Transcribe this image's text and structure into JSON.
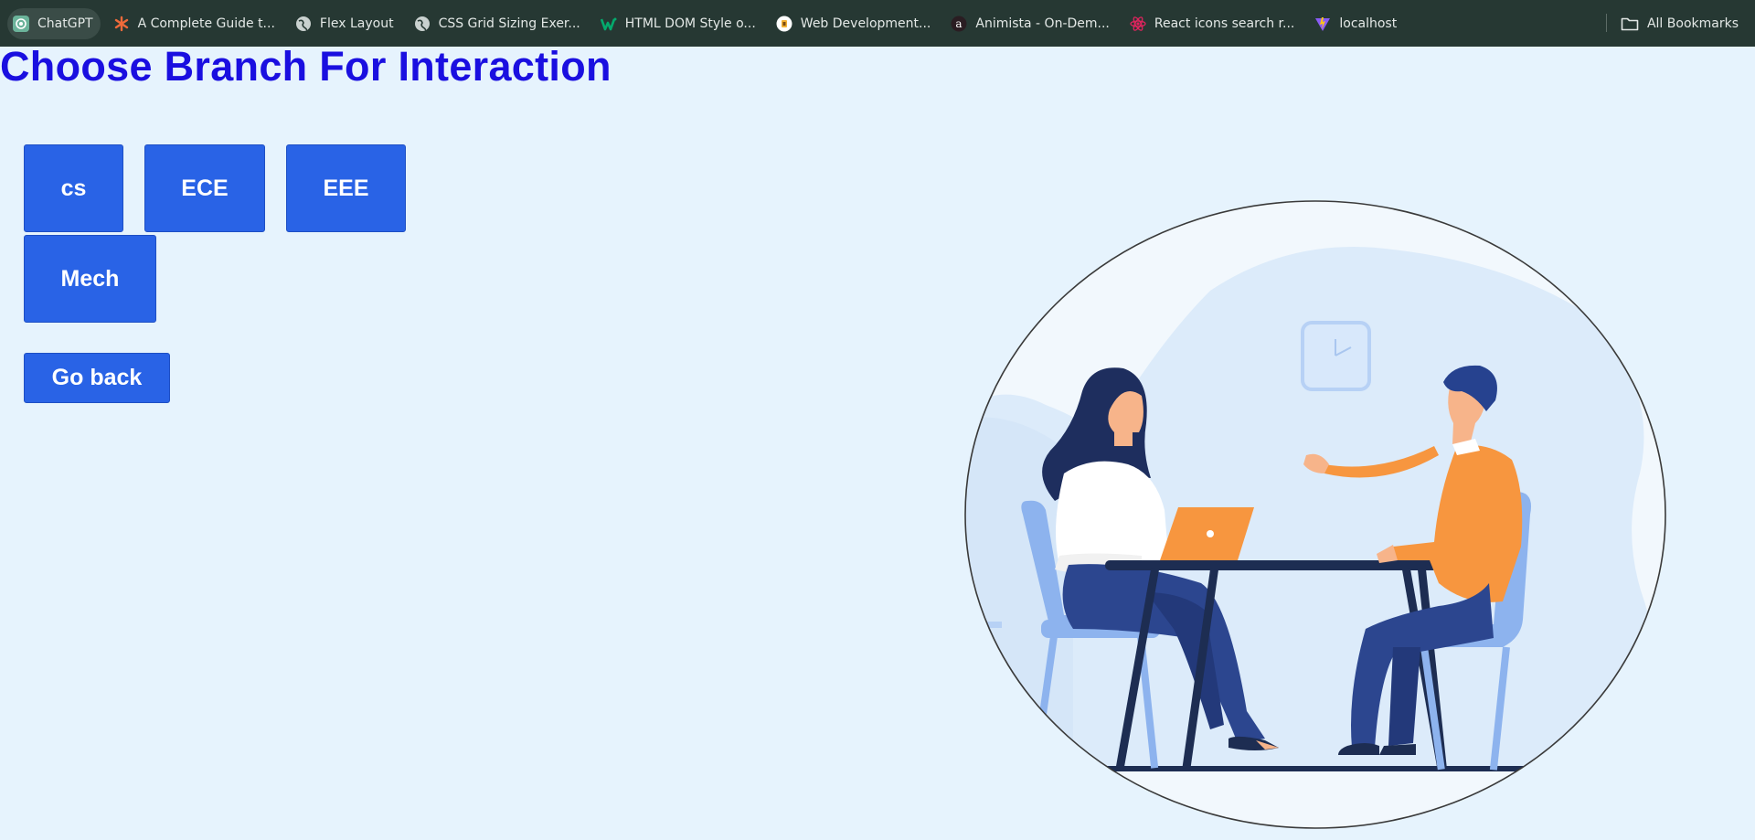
{
  "bookmarks": [
    {
      "label": "ChatGPT",
      "icon": "chatgpt-icon"
    },
    {
      "label": "A Complete Guide t...",
      "icon": "asterisk-icon"
    },
    {
      "label": "Flex Layout",
      "icon": "globe-icon"
    },
    {
      "label": "CSS Grid Sizing Exer...",
      "icon": "globe-icon"
    },
    {
      "label": "HTML DOM Style o...",
      "icon": "w3schools-icon"
    },
    {
      "label": "Web Development...",
      "icon": "web-dev-icon"
    },
    {
      "label": "Animista - On-Dem...",
      "icon": "animista-icon"
    },
    {
      "label": "React icons search r...",
      "icon": "react-icon"
    },
    {
      "label": "localhost",
      "icon": "vite-icon"
    }
  ],
  "all_bookmarks": {
    "label": "All Bookmarks",
    "icon": "folder-icon"
  },
  "page": {
    "title": "Choose Branch For Interaction",
    "branches": [
      "cs",
      "ECE",
      "EEE",
      "Mech"
    ],
    "back_label": "Go back"
  },
  "colors": {
    "background": "#e6f3fd",
    "title": "#1a0fe0",
    "button": "#2963e6",
    "bookmarks_bar": "#263833"
  },
  "illustration": {
    "subject": "interview-illustration"
  }
}
